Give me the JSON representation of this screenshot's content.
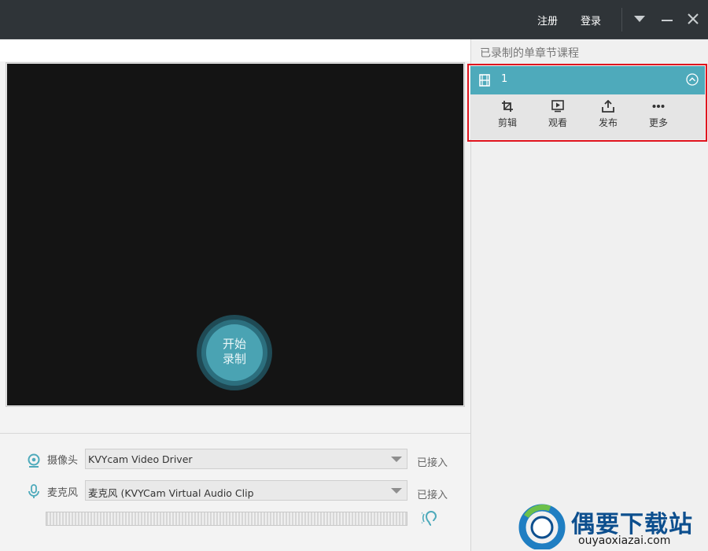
{
  "titlebar": {
    "register_label": "注册",
    "login_label": "登录"
  },
  "preview": {
    "record_button_line1": "开始",
    "record_button_line2": "录制"
  },
  "devices": {
    "camera": {
      "label": "摄像头",
      "selected": "KVYcam Video Driver",
      "status": "已接入",
      "icon": "webcam-icon"
    },
    "microphone": {
      "label": "麦克风",
      "selected": "麦克风 (KVYCam Virtual Audio Clip",
      "status": "已接入",
      "icon": "microphone-icon"
    },
    "listen_icon": "ear-icon"
  },
  "sidebar": {
    "title": "已录制的单章节课程",
    "course": {
      "number": "1",
      "icon": "film-icon",
      "actions": [
        {
          "label": "剪辑",
          "icon": "crop-icon"
        },
        {
          "label": "观看",
          "icon": "play-screen-icon"
        },
        {
          "label": "发布",
          "icon": "upload-icon"
        },
        {
          "label": "更多",
          "icon": "more-icon"
        }
      ]
    }
  },
  "watermark": {
    "name": "偶要下载站",
    "url": "ouyaoxiazai.com"
  },
  "colors": {
    "titlebar": "#2f3438",
    "accent": "#4eaabb",
    "highlight_border": "#e0141e",
    "record_button": "#4aa3b3"
  }
}
